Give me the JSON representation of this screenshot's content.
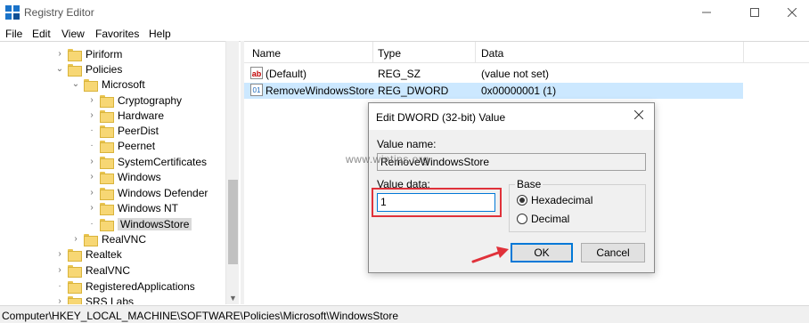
{
  "window": {
    "title": "Registry Editor"
  },
  "menu": [
    "File",
    "Edit",
    "View",
    "Favorites",
    "Help"
  ],
  "tree": [
    {
      "label": "Piriform",
      "has_children": true,
      "expanded": false,
      "selected": false
    },
    {
      "label": "Policies",
      "has_children": true,
      "expanded": true,
      "selected": false
    },
    {
      "label": "Microsoft",
      "has_children": true,
      "expanded": true,
      "selected": false
    },
    {
      "label": "Cryptography",
      "has_children": true,
      "expanded": false,
      "selected": false
    },
    {
      "label": "Hardware",
      "has_children": true,
      "expanded": false,
      "selected": false
    },
    {
      "label": "PeerDist",
      "has_children": false,
      "expanded": false,
      "selected": false
    },
    {
      "label": "Peernet",
      "has_children": false,
      "expanded": false,
      "selected": false
    },
    {
      "label": "SystemCertificates",
      "has_children": true,
      "expanded": false,
      "selected": false
    },
    {
      "label": "Windows",
      "has_children": true,
      "expanded": false,
      "selected": false
    },
    {
      "label": "Windows Defender",
      "has_children": true,
      "expanded": false,
      "selected": false
    },
    {
      "label": "Windows NT",
      "has_children": true,
      "expanded": false,
      "selected": false
    },
    {
      "label": "WindowsStore",
      "has_children": false,
      "expanded": false,
      "selected": true
    },
    {
      "label": "RealVNC",
      "has_children": true,
      "expanded": false,
      "selected": false
    },
    {
      "label": "Realtek",
      "has_children": true,
      "expanded": false,
      "selected": false
    },
    {
      "label": "RealVNC",
      "has_children": true,
      "expanded": false,
      "selected": false
    },
    {
      "label": "RegisteredApplications",
      "has_children": false,
      "expanded": false,
      "selected": false
    },
    {
      "label": "SRS Labs",
      "has_children": true,
      "expanded": false,
      "selected": false
    }
  ],
  "list": {
    "columns": [
      "Name",
      "Type",
      "Data"
    ],
    "rows": [
      {
        "name": "(Default)",
        "type": "REG_SZ",
        "data": "(value not set)",
        "icon": "string-value-icon",
        "selected": false
      },
      {
        "name": "RemoveWindowsStore",
        "type": "REG_DWORD",
        "data": "0x00000001 (1)",
        "icon": "dword-value-icon",
        "selected": true
      }
    ]
  },
  "status": {
    "path": "Computer\\HKEY_LOCAL_MACHINE\\SOFTWARE\\Policies\\Microsoft\\WindowsStore"
  },
  "dialog": {
    "title": "Edit DWORD (32-bit) Value",
    "value_name_label": "Value name:",
    "value_name": "RemoveWindowsStore",
    "value_data_label": "Value data:",
    "value_data": "1",
    "base_label": "Base",
    "base_options": [
      {
        "label": "Hexadecimal",
        "checked": true
      },
      {
        "label": "Decimal",
        "checked": false
      }
    ],
    "ok_label": "OK",
    "cancel_label": "Cancel"
  },
  "watermark": "www.wintips.org",
  "colors": {
    "selection": "#cce8ff",
    "focus": "#0078d7",
    "annotation": "#e0313a",
    "folder": "#f7d774"
  }
}
